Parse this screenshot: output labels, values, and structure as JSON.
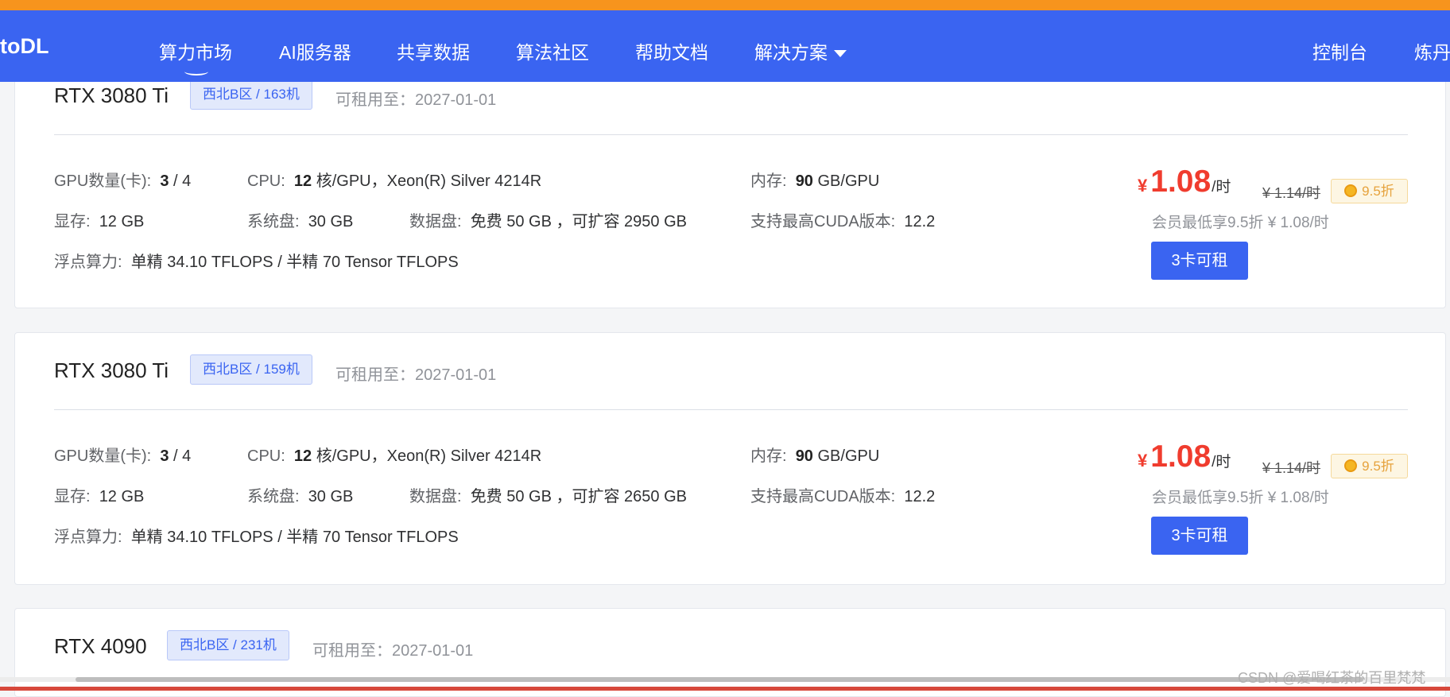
{
  "nav": {
    "logo": "toDL",
    "items": [
      "算力市场",
      "AI服务器",
      "共享数据",
      "算法社区",
      "帮助文档",
      "解决方案"
    ],
    "console": "控制台",
    "user": "炼丹"
  },
  "cards": [
    {
      "gpu_name": "RTX 3080 Ti",
      "region": "西北B区 / 163机",
      "available_label": "可租用至：",
      "available_date": "2027-01-01",
      "gpu_count_label": "GPU数量(卡):",
      "gpu_count_free": "3",
      "gpu_count_total": " / 4",
      "cpu_label": "CPU:",
      "cpu_cores": "12",
      "cpu_rest": " 核/GPU，Xeon(R) Silver 4214R",
      "memory_label": "内存:",
      "memory_value": "90",
      "memory_unit": " GB/GPU",
      "vram_label": "显存:",
      "vram_value": "12 GB",
      "sysdisk_label": "系统盘:",
      "sysdisk_value": "30 GB",
      "datadisk_label": "数据盘:",
      "datadisk_value": "免费 50 GB ，可扩容 2950 GB",
      "cuda_label": "支持最高CUDA版本:",
      "cuda_value": "12.2",
      "flops_label": "浮点算力:",
      "flops_value": "单精 34.10 TFLOPS / 半精 70 Tensor TFLOPS",
      "currency": "¥",
      "price": "1.08",
      "price_unit": "/时",
      "old_price": "¥ 1.14/时",
      "discount": "9.5折",
      "member_price": "会员最低享9.5折 ¥ 1.08/时",
      "rent_button": "3卡可租"
    },
    {
      "gpu_name": "RTX 3080 Ti",
      "region": "西北B区 / 159机",
      "available_label": "可租用至：",
      "available_date": "2027-01-01",
      "gpu_count_label": "GPU数量(卡):",
      "gpu_count_free": "3",
      "gpu_count_total": " / 4",
      "cpu_label": "CPU:",
      "cpu_cores": "12",
      "cpu_rest": " 核/GPU，Xeon(R) Silver 4214R",
      "memory_label": "内存:",
      "memory_value": "90",
      "memory_unit": " GB/GPU",
      "vram_label": "显存:",
      "vram_value": "12 GB",
      "sysdisk_label": "系统盘:",
      "sysdisk_value": "30 GB",
      "datadisk_label": "数据盘:",
      "datadisk_value": "免费 50 GB ，可扩容 2650 GB",
      "cuda_label": "支持最高CUDA版本:",
      "cuda_value": "12.2",
      "flops_label": "浮点算力:",
      "flops_value": "单精 34.10 TFLOPS / 半精 70 Tensor TFLOPS",
      "currency": "¥",
      "price": "1.08",
      "price_unit": "/时",
      "old_price": "¥ 1.14/时",
      "discount": "9.5折",
      "member_price": "会员最低享9.5折 ¥ 1.08/时",
      "rent_button": "3卡可租"
    },
    {
      "gpu_name": "RTX 4090",
      "region": "西北B区 / 231机",
      "available_label": "可租用至：",
      "available_date": "2027-01-01"
    }
  ],
  "watermark": "CSDN @爱喝红茶的百里梵梵"
}
